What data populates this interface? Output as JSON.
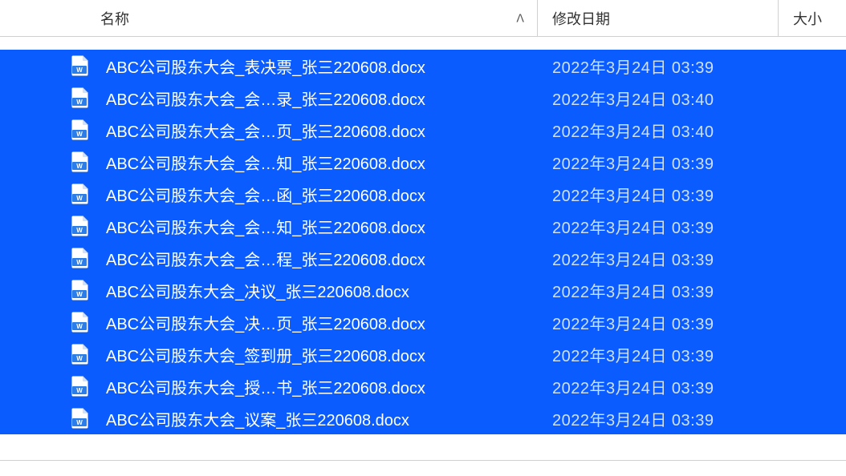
{
  "columns": {
    "name": "名称",
    "date": "修改日期",
    "size": "大小"
  },
  "sort_indicator": "ᐱ",
  "files": [
    {
      "name": "ABC公司股东大会_表决票_张三220608.docx",
      "date": "2022年3月24日 03:39"
    },
    {
      "name": "ABC公司股东大会_会…录_张三220608.docx",
      "date": "2022年3月24日 03:40"
    },
    {
      "name": "ABC公司股东大会_会…页_张三220608.docx",
      "date": "2022年3月24日 03:40"
    },
    {
      "name": "ABC公司股东大会_会…知_张三220608.docx",
      "date": "2022年3月24日 03:39"
    },
    {
      "name": "ABC公司股东大会_会…函_张三220608.docx",
      "date": "2022年3月24日 03:39"
    },
    {
      "name": "ABC公司股东大会_会…知_张三220608.docx",
      "date": "2022年3月24日 03:39"
    },
    {
      "name": "ABC公司股东大会_会…程_张三220608.docx",
      "date": "2022年3月24日 03:39"
    },
    {
      "name": "ABC公司股东大会_决议_张三220608.docx",
      "date": "2022年3月24日 03:39"
    },
    {
      "name": "ABC公司股东大会_决…页_张三220608.docx",
      "date": "2022年3月24日 03:39"
    },
    {
      "name": "ABC公司股东大会_签到册_张三220608.docx",
      "date": "2022年3月24日 03:39"
    },
    {
      "name": "ABC公司股东大会_授…书_张三220608.docx",
      "date": "2022年3月24日 03:39"
    },
    {
      "name": "ABC公司股东大会_议案_张三220608.docx",
      "date": "2022年3月24日 03:39"
    }
  ]
}
